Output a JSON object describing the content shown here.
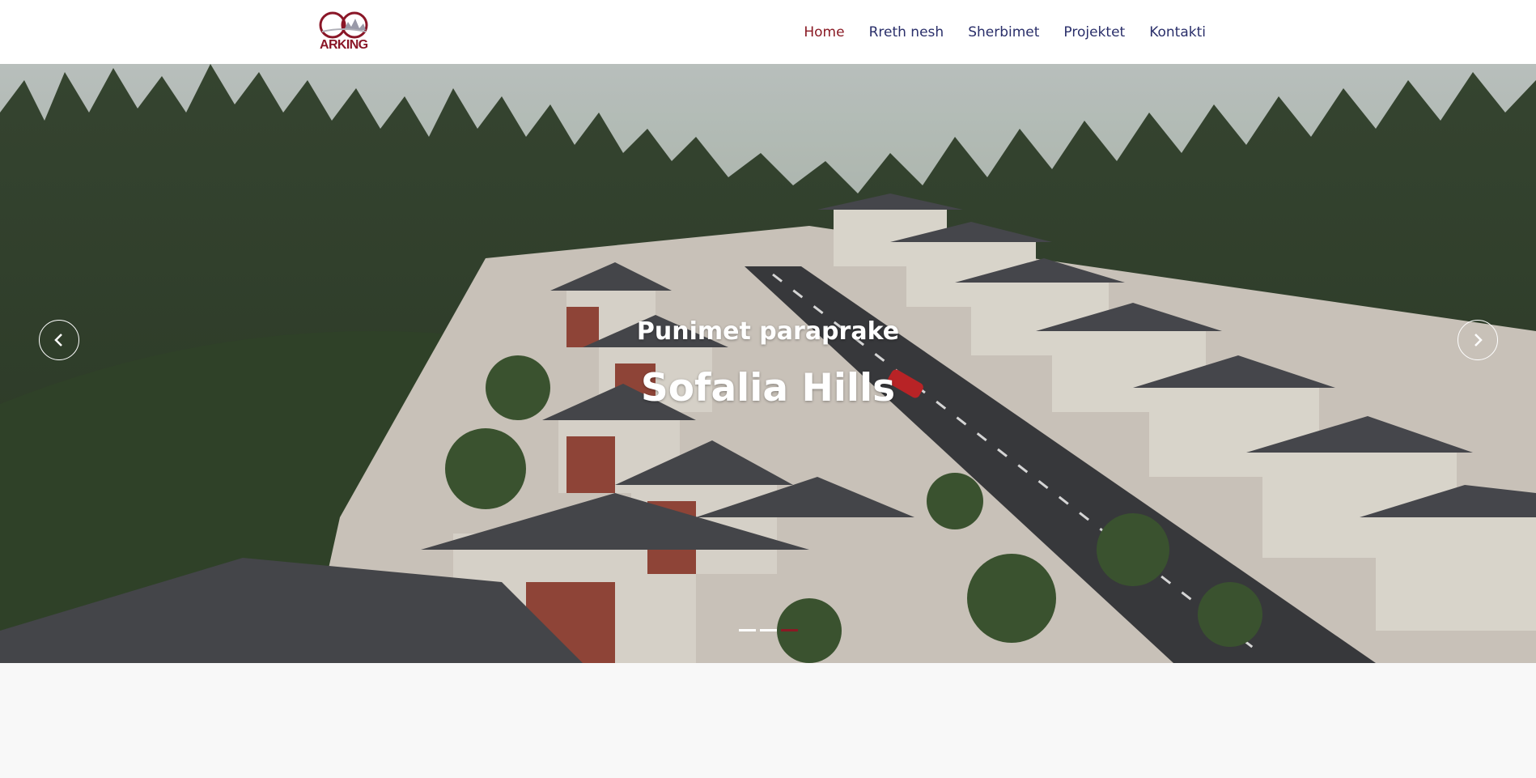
{
  "brand": {
    "logo_text": "ARKING",
    "primary_color": "#8a1a24",
    "nav_color": "#2a2f6a"
  },
  "nav": {
    "items": [
      {
        "label": "Home",
        "active": true
      },
      {
        "label": "Rreth nesh",
        "active": false
      },
      {
        "label": "Sherbimet",
        "active": false
      },
      {
        "label": "Projektet",
        "active": false
      },
      {
        "label": "Kontakti",
        "active": false
      }
    ]
  },
  "slider": {
    "subtitle": "Punimet paraprake",
    "title": "Sofalia Hills",
    "prev_icon": "chevron-left-icon",
    "next_icon": "chevron-right-icon",
    "slide_count": 3,
    "active_slide": 3
  }
}
